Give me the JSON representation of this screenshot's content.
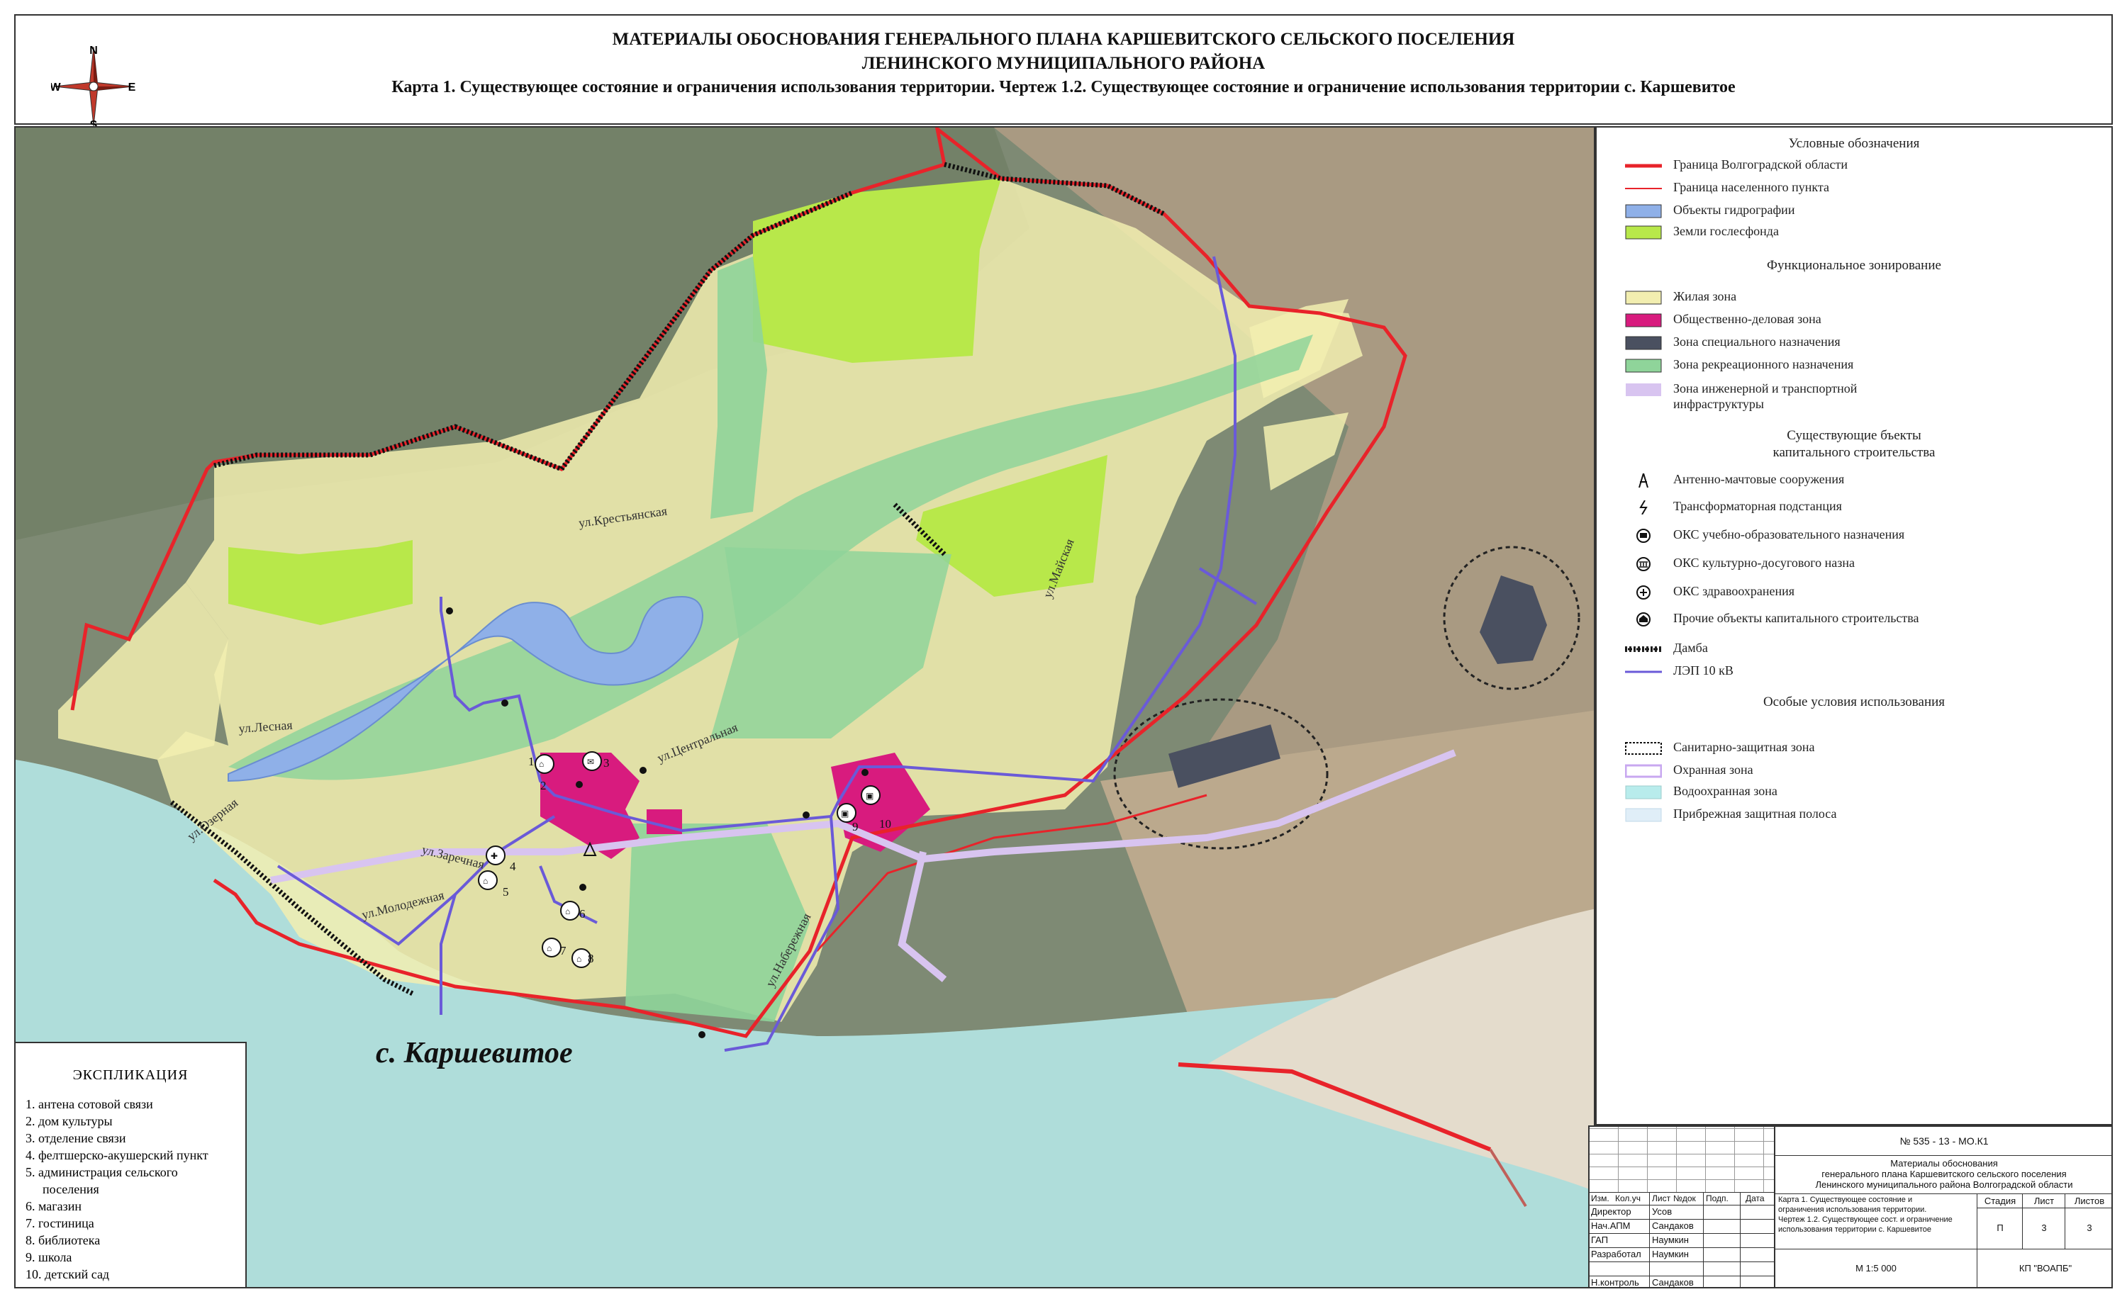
{
  "header": {
    "title_line1": "МАТЕРИАЛЫ ОБОСНОВАНИЯ ГЕНЕРАЛЬНОГО ПЛАНА КАРШЕВИТСКОГО СЕЛЬСКОГО ПОСЕЛЕНИЯ",
    "title_line2": "ЛЕНИНСКОГО МУНИЦИПАЛЬНОГО РАЙОНА",
    "title_line3": "Карта 1. Существующее состояние и ограничения использования территории. Чертеж 1.2. Существующее состояние и ограничение использования территории с. Каршевитое"
  },
  "compass": {
    "n": "N",
    "s": "S",
    "w": "W",
    "e": "E"
  },
  "map": {
    "settlement_name": "с. Каршевитое",
    "streets": {
      "krestyanskaya": "ул.Крестьянская",
      "lesnaya": "ул.Лесная",
      "tsentralnaya": "ул.Центральная",
      "ozernaya": "ул.Озерная",
      "zarechnaya": "ул.Заречная",
      "molodezhnaya": "ул.Молодежная",
      "naberezhnaya": "ул.Набережная",
      "mayskaya": "ул.Майская"
    },
    "object_numbers": [
      "1",
      "2",
      "3",
      "4",
      "5",
      "6",
      "7",
      "8",
      "9",
      "10"
    ],
    "colors": {
      "region_border": "#e8232a",
      "residential": "#f2eeb0",
      "public": "#d81b7e",
      "special": "#4a5060",
      "recreation": "#8fd49a",
      "forest": "#b8e84a",
      "hydro": "#8fb0e8",
      "infra": "#d8c4f0",
      "power_line": "#6a5ad8",
      "water_zone": "#b8ecec"
    }
  },
  "legend": {
    "title": "Условные обозначения",
    "items_main": [
      {
        "icon": "red-line",
        "label": "Граница Волгоградской области"
      },
      {
        "icon": "thin-red-line",
        "label": "Граница населенного пункта"
      },
      {
        "icon": "blue-fill",
        "label": "Объекты гидрографии"
      },
      {
        "icon": "green-fill",
        "label": "Земли гослесфонда"
      }
    ],
    "zoning_title": "Функциональное зонирование",
    "zoning_items": [
      {
        "icon": "yellow-fill",
        "label": "Жилая зона"
      },
      {
        "icon": "magenta-fill",
        "label": "Общественно-деловая зона"
      },
      {
        "icon": "dark-fill",
        "label": "Зона специального назначения"
      },
      {
        "icon": "light-green-fill",
        "label": "Зона рекреационного назначения"
      },
      {
        "icon": "lilac-fill",
        "label": "Зона инженерной и транспортной",
        "label2": "инфраструктуры"
      }
    ],
    "existing_title_1": "Существующие бъекты",
    "existing_title_2": "капитального строительства",
    "existing_items": [
      {
        "icon": "antenna-icon",
        "label": "Антенно-мачтовые сооружения"
      },
      {
        "icon": "transformer-icon",
        "label": "Трансформаторная подстанция"
      },
      {
        "icon": "education-icon",
        "label": "ОКС учебно-образовательного назначения"
      },
      {
        "icon": "culture-icon",
        "label": "ОКС культурно-досугового назна"
      },
      {
        "icon": "health-icon",
        "label": "ОКС здравоохранения"
      },
      {
        "icon": "other-building-icon",
        "label": "Прочие объекты капитального строительства"
      },
      {
        "icon": "dam-line",
        "label": "Дамба"
      },
      {
        "icon": "power-line",
        "label": "ЛЭП 10 кВ"
      }
    ],
    "special_title": "Особые условия использования",
    "special_items": [
      {
        "icon": "sanitary-zone",
        "label": "Санитарно-защитная зона"
      },
      {
        "icon": "protection-zone",
        "label": "Охранная зона"
      },
      {
        "icon": "water-protection-zone",
        "label": "Водоохранная зона"
      },
      {
        "icon": "coastal-strip",
        "label": "Прибрежная защитная полоса"
      }
    ]
  },
  "explication": {
    "title": "ЭКСПЛИКАЦИЯ",
    "items": [
      "1. антена сотовой связи",
      "2. дом культуры",
      "3. отделение связи",
      "4. фелтшерско-акушерский пункт",
      "5. администрация сельского",
      "поселения",
      "6. магазин",
      "7. гостиница",
      "8. библиотека",
      "9. школа",
      "10. детский сад"
    ]
  },
  "stamp": {
    "code": "№ 535 - 13 - МО.К1",
    "desc1": "Материалы обоснования",
    "desc2": "генерального плана Каршевитского сельского поселения",
    "desc3": "Ленинского муниципального района Волгоградской области",
    "cols": [
      "Изм.",
      "Кол.уч",
      "Лист",
      "№док",
      "Подп.",
      "Дата"
    ],
    "roles": [
      {
        "role": "Директор",
        "name": "Усов"
      },
      {
        "role": "Нач.АПМ",
        "name": "Сандаков"
      },
      {
        "role": "ГАП",
        "name": "Наумкин"
      },
      {
        "role": "Разработал",
        "name": "Наумкин"
      },
      {
        "role": "",
        "name": ""
      },
      {
        "role": "Н.контроль",
        "name": "Сандаков"
      }
    ],
    "sheet_desc1": "Карта 1. Существующее состояние и",
    "sheet_desc2": "ограничения использования территории.",
    "sheet_desc3": "Чертеж 1.2. Существующее сост. и ограничение",
    "sheet_desc4": "использования территории с. Каршевитое",
    "stage_label": "Стадия",
    "sheet_label": "Лист",
    "sheets_label": "Листов",
    "stage": "П",
    "sheet": "3",
    "sheets": "3",
    "scale": "М 1:5 000",
    "org": "КП \"ВОАПБ\""
  }
}
